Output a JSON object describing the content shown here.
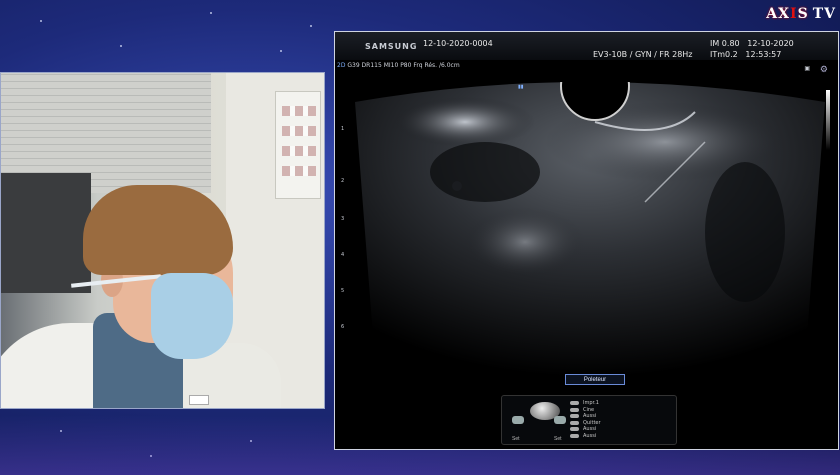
{
  "logo": {
    "text_a": "AX",
    "text_i": "I",
    "text_s": "S",
    "text_tv": "TV"
  },
  "ultrasound": {
    "brand": "SAMSUNG",
    "exam_id": "12-10-2020-0004",
    "probe_info": "EV3-10B / GYN / FR 28Hz",
    "mi": "IM  0.80",
    "date": "12-10-2020",
    "tib": "ITm0.2",
    "time": "12:53:57",
    "mode": "2D",
    "params": "G39 DR115 MI10 P80 Frq Rés. /6.0cm",
    "depth_marks": [
      "1",
      "2",
      "3",
      "4",
      "5",
      "6"
    ],
    "preset_button": "Poleteur",
    "controls": [
      "Impr.1",
      "Cine",
      "Aussi",
      "Quitter",
      "Aussi",
      "Aussi"
    ],
    "set_left": "Set",
    "set_right": "Set"
  },
  "colors": {
    "background": "#1d2a7a",
    "accent_blue": "#7fb0ff",
    "logo_red": "#e01010"
  }
}
